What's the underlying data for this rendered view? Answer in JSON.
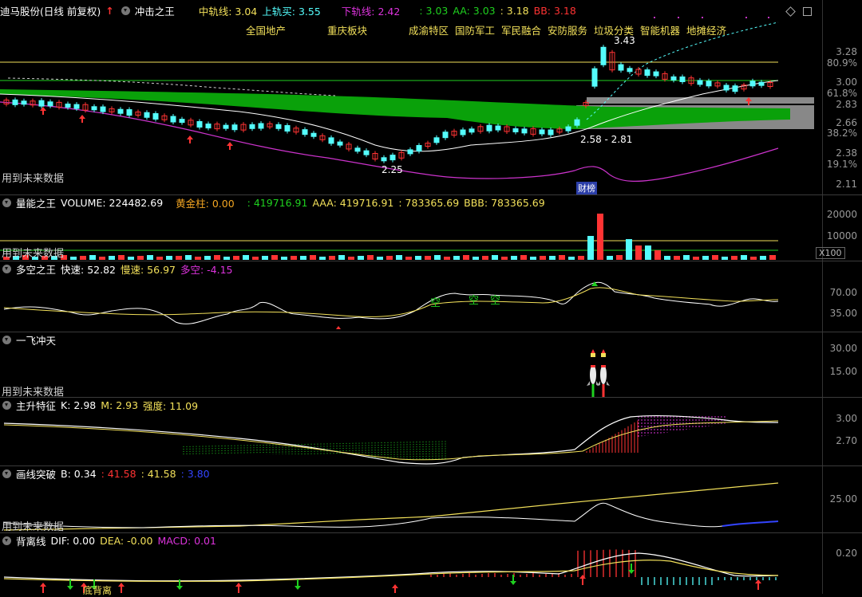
{
  "colors": {
    "up": "#ff3333",
    "down": "#54fcfc",
    "yellow": "#f2e05a",
    "white": "#ffffff",
    "magenta": "#cc33cc",
    "green": "#1fd11f",
    "gray": "#888888"
  },
  "main": {
    "title": "迪马股份(日线 前复权)",
    "indicator": "冲击之王",
    "mid_label": "中轨线: 3.04",
    "up_label": "上轨买: 3.55",
    "low_label": "下轨线: 2.42",
    "v1": ": 3.03",
    "aa": "AA: 3.03",
    "v2": ": 3.18",
    "bb": "BB: 3.18",
    "future_text": "用到未来数据",
    "stocks_top": [
      "全国地产",
      "重庆板块"
    ],
    "stocks_mid": [
      "成渝特区",
      "国防军工",
      "军民融合",
      "安防服务",
      "垃圾分类",
      "智能机器",
      "地摊经济"
    ],
    "hi_label": "3.43",
    "lo_label": "2.25",
    "band_label": "2.58 - 2.81",
    "badge": "财榜",
    "ticks": [
      "3.28",
      "80.9%",
      "3.00",
      "61.8%",
      "2.83",
      "2.66",
      "38.2%",
      "2.38",
      "19.1%",
      "2.11"
    ]
  },
  "vol": {
    "title": "量能之王",
    "volume": "VOLUME: 224482.69",
    "gold": "黄金柱: 0.00",
    "v1": ": 419716.91",
    "aaa": "AAA: 419716.91",
    "v2": ": 783365.69",
    "bbb": "BBB: 783365.69",
    "future_text": "用到未来数据",
    "ticks": [
      "20000",
      "10000"
    ],
    "unit": "X100"
  },
  "dk": {
    "title": "多空之王",
    "fast": "快速: 52.82",
    "slow": "慢速: 56.97",
    "diff": "多空: -4.15",
    "kong": "空",
    "ticks": [
      "70.00",
      "35.00"
    ]
  },
  "yf": {
    "title": "一飞冲天",
    "future_text": "用到未来数据",
    "ticks": [
      "30.00",
      "15.00"
    ]
  },
  "zs": {
    "title": "主升特征",
    "k": "K: 2.98",
    "m": "M: 2.93",
    "q": "强度: 11.09",
    "ticks": [
      "3.00",
      "2.70"
    ]
  },
  "hx": {
    "title": "画线突破",
    "b": "B: 0.34",
    "v1": ": 41.58",
    "v2": ": 41.58",
    "v3": ": 3.80",
    "future_text": "用到未来数据",
    "ticks": [
      "25.00"
    ]
  },
  "bl": {
    "title": "背离线",
    "dif": "DIF: 0.00",
    "dea": "DEA: -0.00",
    "macd": "MACD: 0.01",
    "div": "底背离",
    "ticks": [
      "0.20"
    ]
  }
}
